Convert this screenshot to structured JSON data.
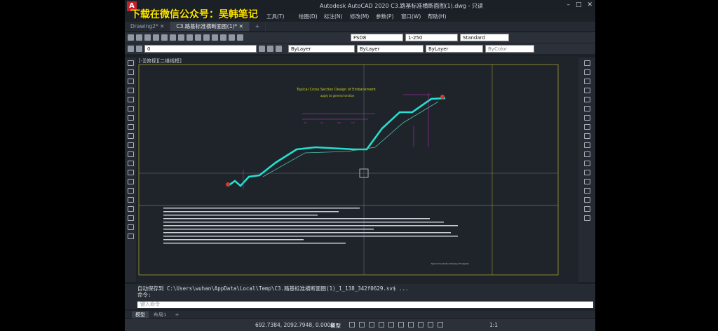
{
  "watermark": "下载在微信公众号：吴韩笔记",
  "window": {
    "app_title": "Autodesk AutoCAD 2020    C3.路基标准横断面图(1).dwg - 只读"
  },
  "menu": [
    "工具(T)",
    "绘图(D)",
    "标注(N)",
    "修改(M)",
    "参数(P)",
    "窗口(W)",
    "帮助(H)"
  ],
  "tabs": [
    {
      "label": "Drawing2*"
    },
    {
      "label": "C3.路基标准横断面图(1)*"
    }
  ],
  "toolbar": {
    "textstyle": "FSD8",
    "dimstyle": "1-250",
    "tablestyle": "Standard",
    "layer": "0",
    "color": "ByLayer",
    "linetype": "ByLayer",
    "lineweight": "ByLayer",
    "plotstyle": "ByColor"
  },
  "canvas": {
    "view_label": "[-][俯视][二维线框]",
    "drawing_title": "Typical Cross Section Design of Embankment",
    "drawing_subtitle": "apply to general section",
    "title_block_text": "Typical Cross-Section Drawing of Subgrade"
  },
  "command": {
    "line1": "自动保存到 C:\\Users\\wuhan\\AppData\\Local\\Temp\\C3.路基标准横断面图(1)_1_138_342f0629.sv$ ...",
    "line2": "命令:",
    "input_placeholder": "键入命令"
  },
  "layout_tabs": [
    "模型",
    "布局1"
  ],
  "status": {
    "coords": "692.7384, 2092.7948, 0.0000",
    "model": "模型",
    "scale": "1:1"
  },
  "colors": {
    "accent_cyan": "#23e0d0",
    "title_green": "#c8d21a",
    "annotation_magenta": "#c437c4"
  }
}
